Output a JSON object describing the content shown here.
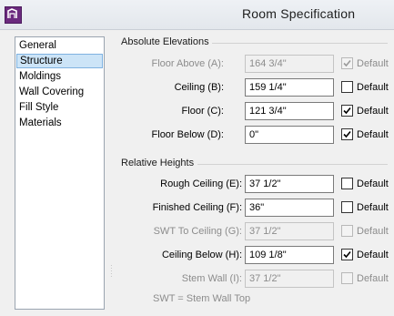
{
  "window": {
    "title": "Room Specification",
    "accent": "#6b2a7e"
  },
  "sidebar": {
    "items": [
      {
        "label": "General",
        "selected": false
      },
      {
        "label": "Structure",
        "selected": true
      },
      {
        "label": "Moldings",
        "selected": false
      },
      {
        "label": "Wall Covering",
        "selected": false
      },
      {
        "label": "Fill Style",
        "selected": false
      },
      {
        "label": "Materials",
        "selected": false
      }
    ]
  },
  "absolute": {
    "heading": "Absolute Elevations",
    "rows": [
      {
        "label": "Floor Above (A):",
        "value": "164 3/4\"",
        "enabled": false,
        "default_label": "Default",
        "default_checked": true,
        "default_enabled": false
      },
      {
        "label": "Ceiling (B):",
        "value": "159 1/4\"",
        "enabled": true,
        "default_label": "Default",
        "default_checked": false,
        "default_enabled": true
      },
      {
        "label": "Floor (C):",
        "value": "121 3/4\"",
        "enabled": true,
        "default_label": "Default",
        "default_checked": true,
        "default_enabled": true
      },
      {
        "label": "Floor Below (D):",
        "value": "0\"",
        "enabled": true,
        "default_label": "Default",
        "default_checked": true,
        "default_enabled": true
      }
    ]
  },
  "relative": {
    "heading": "Relative Heights",
    "rows": [
      {
        "label": "Rough Ceiling (E):",
        "value": "37 1/2\"",
        "enabled": true,
        "default_label": "Default",
        "default_checked": false,
        "default_enabled": true
      },
      {
        "label": "Finished Ceiling (F):",
        "value": "36\"",
        "enabled": true,
        "default_label": "Default",
        "default_checked": false,
        "default_enabled": true
      },
      {
        "label": "SWT To Ceiling (G):",
        "value": "37 1/2\"",
        "enabled": false,
        "default_label": "Default",
        "default_checked": false,
        "default_enabled": false
      },
      {
        "label": "Ceiling Below (H):",
        "value": "109 1/8\"",
        "enabled": true,
        "default_label": "Default",
        "default_checked": true,
        "default_enabled": true
      },
      {
        "label": "Stem Wall (I):",
        "value": "37 1/2\"",
        "enabled": false,
        "default_label": "Default",
        "default_checked": false,
        "default_enabled": false
      }
    ],
    "note": "SWT = Stem Wall Top"
  }
}
